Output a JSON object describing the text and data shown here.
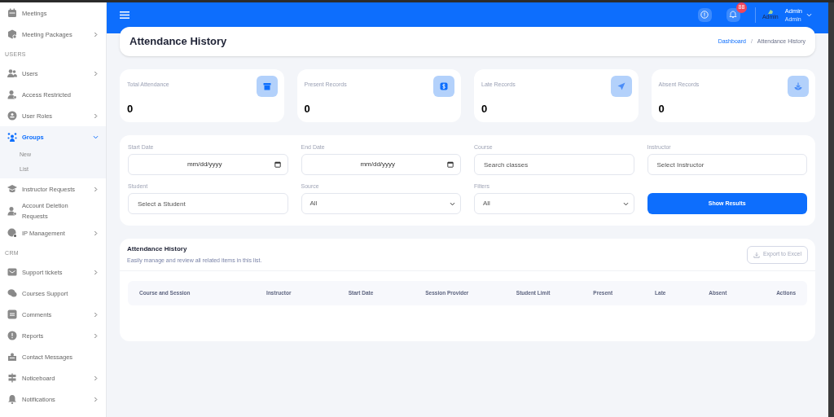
{
  "sidebar": {
    "items": [
      {
        "kind": "item",
        "label": "Meetings",
        "has_submenu": false,
        "selected": false
      },
      {
        "kind": "item",
        "label": "Meeting Packages",
        "has_submenu": true,
        "selected": false
      },
      {
        "kind": "section",
        "label": "USERS"
      },
      {
        "kind": "item",
        "label": "Users",
        "has_submenu": true,
        "selected": false
      },
      {
        "kind": "item",
        "label": "Access Restricted",
        "has_submenu": false,
        "selected": false
      },
      {
        "kind": "item",
        "label": "User Roles",
        "has_submenu": true,
        "selected": false
      },
      {
        "kind": "item",
        "label": "Groups",
        "has_submenu": true,
        "selected": true,
        "expanded": true,
        "children": [
          {
            "label": "New"
          },
          {
            "label": "List"
          }
        ]
      },
      {
        "kind": "item",
        "label": "Instructor Requests",
        "has_submenu": true,
        "selected": false
      },
      {
        "kind": "item",
        "label": "Account Deletion Requests",
        "has_submenu": false,
        "selected": false
      },
      {
        "kind": "item",
        "label": "IP Management",
        "has_submenu": true,
        "selected": false
      },
      {
        "kind": "section",
        "label": "CRM"
      },
      {
        "kind": "item",
        "label": "Support tickets",
        "has_submenu": true,
        "selected": false
      },
      {
        "kind": "item",
        "label": "Courses Support",
        "has_submenu": false,
        "selected": false
      },
      {
        "kind": "item",
        "label": "Comments",
        "has_submenu": true,
        "selected": false
      },
      {
        "kind": "item",
        "label": "Reports",
        "has_submenu": true,
        "selected": false
      },
      {
        "kind": "item",
        "label": "Contact Messages",
        "has_submenu": false,
        "selected": false
      },
      {
        "kind": "item",
        "label": "Noticeboard",
        "has_submenu": true,
        "selected": false
      },
      {
        "kind": "item",
        "label": "Notifications",
        "has_submenu": true,
        "selected": false
      }
    ]
  },
  "header": {
    "notification_count": "88",
    "avatar_alt": "Admin",
    "user_name": "Admin",
    "user_role": "Admin"
  },
  "page": {
    "title": "Attendance History",
    "breadcrumb_separator": "/",
    "breadcrumb": [
      {
        "label": "Dashboard",
        "link": true
      },
      {
        "label": "Attendance History",
        "link": false
      }
    ]
  },
  "stats": [
    {
      "label": "Total Attendance",
      "value": "0"
    },
    {
      "label": "Present Records",
      "value": "0"
    },
    {
      "label": "Late Records",
      "value": "0"
    },
    {
      "label": "Absent Records",
      "value": "0"
    }
  ],
  "filters": [
    {
      "kind": "date",
      "label": "Start Date",
      "placeholder": "mm/dd/yyyy"
    },
    {
      "kind": "date",
      "label": "End Date",
      "placeholder": "mm/dd/yyyy"
    },
    {
      "kind": "text",
      "label": "Course",
      "placeholder": "Search classes"
    },
    {
      "kind": "text",
      "label": "Instructor",
      "placeholder": "Select Instructor"
    },
    {
      "kind": "text",
      "label": "Student",
      "placeholder": "Select a Student"
    },
    {
      "kind": "select",
      "label": "Source",
      "value": "All"
    },
    {
      "kind": "select",
      "label": "Filters",
      "value": "All"
    },
    {
      "kind": "button",
      "label": "Show Results"
    }
  ],
  "table": {
    "title": "Attendance History",
    "subtitle": "Easily manage and review all related items in this list.",
    "export_button": "Export to Excel",
    "columns": [
      "Course and Session",
      "Instructor",
      "Start Date",
      "Session Provider",
      "Student Limit",
      "Present",
      "Late",
      "Absent",
      "Actions"
    ]
  }
}
